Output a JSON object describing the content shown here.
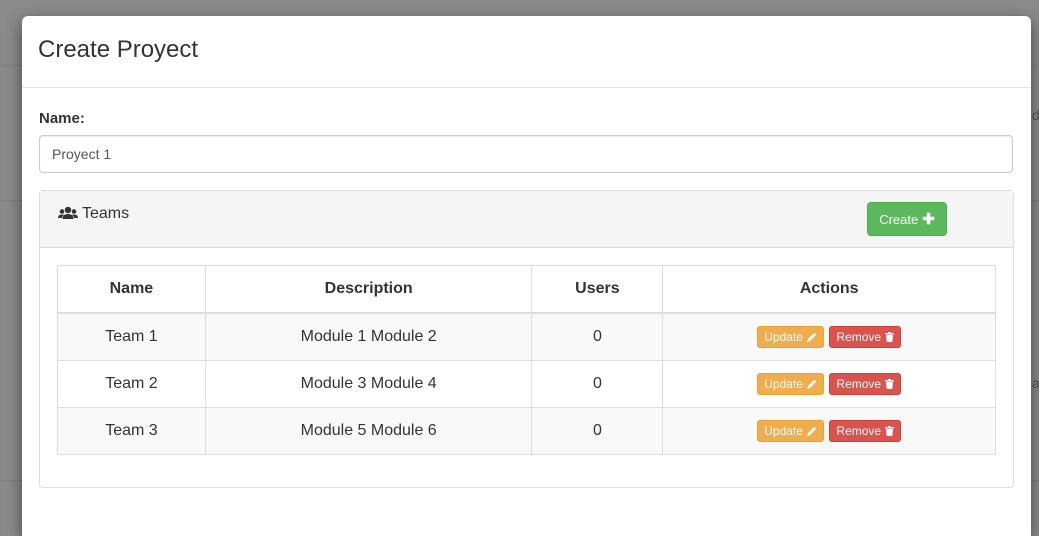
{
  "background": {
    "edge_text_top": "d",
    "edge_text_bottom": "a"
  },
  "modal": {
    "title": "Create Proyect",
    "name_label": "Name:",
    "name_value": "Proyect 1"
  },
  "teams_panel": {
    "title": "Teams",
    "title_icon": "users-icon",
    "create_label": "Create",
    "create_icon": "plus-icon"
  },
  "table": {
    "headers": [
      "Name",
      "Description",
      "Users",
      "Actions"
    ],
    "rows": [
      {
        "name": "Team 1",
        "description": "Module 1 Module 2",
        "users": "0",
        "update_label": "Update",
        "remove_label": "Remove"
      },
      {
        "name": "Team 2",
        "description": "Module 3 Module 4",
        "users": "0",
        "update_label": "Update",
        "remove_label": "Remove"
      },
      {
        "name": "Team 3",
        "description": "Module 5 Module 6",
        "users": "0",
        "update_label": "Update",
        "remove_label": "Remove"
      }
    ],
    "update_icon": "pencil-icon",
    "remove_icon": "trash-icon"
  },
  "colors": {
    "create_button": "#5cb85c",
    "update_button": "#f0ad4e",
    "remove_button": "#d9534f",
    "overlay": "#8a8a8a"
  }
}
